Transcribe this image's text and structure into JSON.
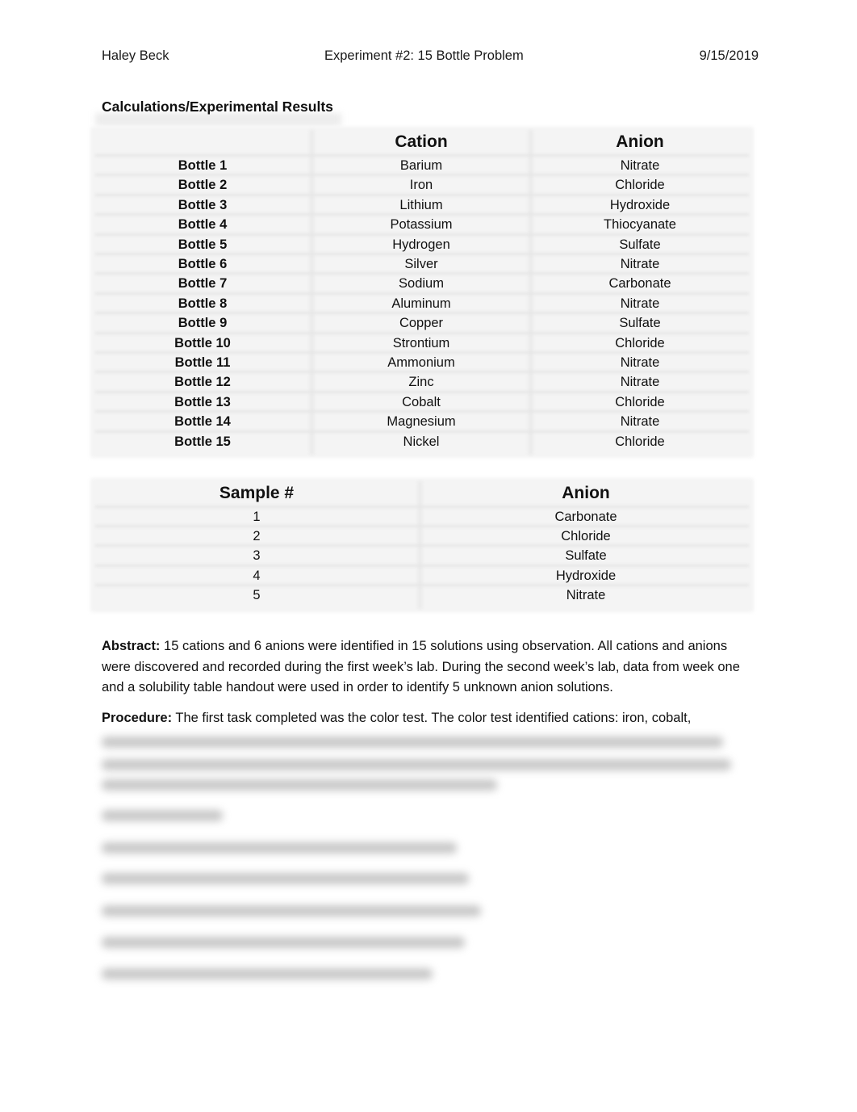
{
  "header": {
    "author": "Haley Beck",
    "title": "Experiment #2: 15 Bottle Problem",
    "date": "9/15/2019"
  },
  "section_title": "Calculations/Experimental Results",
  "bottle_table": {
    "columns": [
      "",
      "Cation",
      "Anion"
    ],
    "rows": [
      {
        "bottle": "Bottle 1",
        "cation": "Barium",
        "anion": "Nitrate"
      },
      {
        "bottle": "Bottle 2",
        "cation": "Iron",
        "anion": "Chloride"
      },
      {
        "bottle": "Bottle 3",
        "cation": "Lithium",
        "anion": "Hydroxide"
      },
      {
        "bottle": "Bottle 4",
        "cation": "Potassium",
        "anion": "Thiocyanate"
      },
      {
        "bottle": "Bottle 5",
        "cation": "Hydrogen",
        "anion": "Sulfate"
      },
      {
        "bottle": "Bottle 6",
        "cation": "Silver",
        "anion": "Nitrate"
      },
      {
        "bottle": "Bottle 7",
        "cation": "Sodium",
        "anion": "Carbonate"
      },
      {
        "bottle": "Bottle 8",
        "cation": "Aluminum",
        "anion": "Nitrate"
      },
      {
        "bottle": "Bottle 9",
        "cation": "Copper",
        "anion": "Sulfate"
      },
      {
        "bottle": "Bottle 10",
        "cation": "Strontium",
        "anion": "Chloride"
      },
      {
        "bottle": "Bottle 11",
        "cation": "Ammonium",
        "anion": "Nitrate"
      },
      {
        "bottle": "Bottle 12",
        "cation": "Zinc",
        "anion": "Nitrate"
      },
      {
        "bottle": "Bottle 13",
        "cation": "Cobalt",
        "anion": "Chloride"
      },
      {
        "bottle": "Bottle 14",
        "cation": "Magnesium",
        "anion": "Nitrate"
      },
      {
        "bottle": "Bottle 15",
        "cation": "Nickel",
        "anion": "Chloride"
      }
    ]
  },
  "sample_table": {
    "columns": [
      "Sample #",
      "Anion"
    ],
    "rows": [
      {
        "sample": "1",
        "anion": "Carbonate"
      },
      {
        "sample": "2",
        "anion": "Chloride"
      },
      {
        "sample": "3",
        "anion": "Sulfate"
      },
      {
        "sample": "4",
        "anion": "Hydroxide"
      },
      {
        "sample": "5",
        "anion": "Nitrate"
      }
    ]
  },
  "abstract": {
    "label": "Abstract:",
    "text": " 15 cations and 6 anions were identified in 15 solutions using observation. All cations and anions were discovered and recorded during the first week’s lab. During the second week’s lab, data from week one and a solubility table handout were used in order to identify 5 unknown anion solutions."
  },
  "procedure": {
    "label": "Procedure:",
    "text": " The first task completed was the color test. The color test identified cations: iron, cobalt,"
  }
}
